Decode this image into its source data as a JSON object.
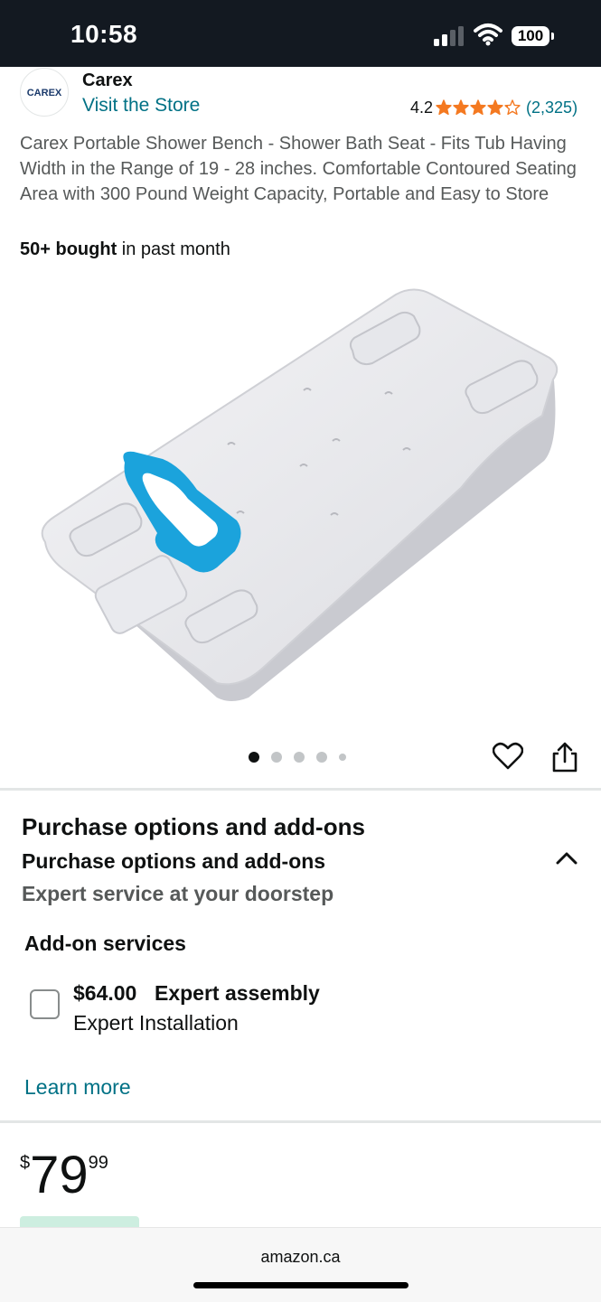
{
  "status_bar": {
    "time": "10:58",
    "battery": "100",
    "signal_icon": "cellular-signal-icon",
    "wifi_icon": "wifi-icon"
  },
  "brand": {
    "logo_text": "CAREX",
    "name": "Carex",
    "store_link": "Visit the Store"
  },
  "rating": {
    "value": "4.2",
    "stars": 4.2,
    "max_stars": 5,
    "count": "(2,325)",
    "star_color": "#f47921"
  },
  "product": {
    "title": "Carex Portable Shower Bench - Shower Bath Seat - Fits Tub Having Width in the Range of 19 - 28 inches. Comfortable Contoured Seating Area with 300 Pound Weight Capacity, Portable and Easy to Store",
    "bought_strong": "50+ bought",
    "bought_rest": " in past month",
    "image_icon": "shower-bench-image"
  },
  "carousel": {
    "dots_total": 5,
    "active_index": 0
  },
  "actions": {
    "wishlist_icon": "heart-icon",
    "share_icon": "share-icon"
  },
  "purchase_options": {
    "title": "Purchase options and add-ons",
    "subtitle": "Purchase options and add-ons",
    "caption": "Expert service at your doorstep",
    "collapse_icon": "chevron-up-icon",
    "addon_heading": "Add-on services",
    "addon": {
      "price": "$64.00",
      "name": "Expert assembly",
      "description": "Expert Installation",
      "checked": false
    },
    "learn_more": "Learn more"
  },
  "price": {
    "symbol": "$",
    "whole": "79",
    "fraction": "99"
  },
  "browser": {
    "url": "amazon.ca"
  },
  "colors": {
    "header_bg": "#131921",
    "link": "#007185",
    "text": "#0f1111",
    "secondary_text": "#565959",
    "handle_blue": "#1ba3dc"
  }
}
